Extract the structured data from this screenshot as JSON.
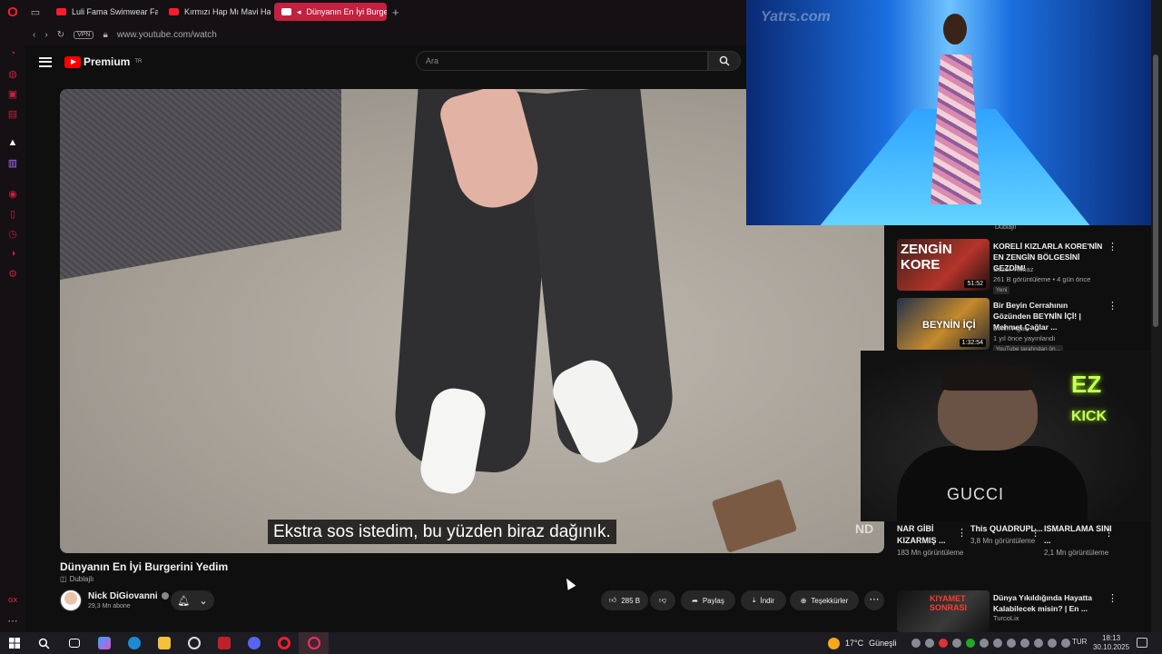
{
  "browser": {
    "tabs": [
      {
        "label": "Luli Fama Swimwear Fash"
      },
      {
        "label": "Kırmızı Hap Mı Mavi Hap"
      },
      {
        "label": "Dünyanın En İyi Burge"
      }
    ],
    "vpn_label": "VPN",
    "url": "www.youtube.com/watch",
    "sidebar_bottom_label": "GX"
  },
  "youtube": {
    "logo_text": "Premium",
    "logo_region": "TR",
    "search_placeholder": "Ara"
  },
  "video": {
    "subtitle": "Ekstra sos istedim, bu yüzden biraz dağınık.",
    "watermark": "ND",
    "title": "Dünyanın En İyi Burgerini Yedim",
    "dubbed_label": "Dublajlı",
    "channel_name": "Nick DiGiovanni",
    "subscribers": "29,3 Mn abone",
    "like_count": "285 B",
    "share_label": "Paylaş",
    "download_label": "İndir",
    "thanks_label": "Teşekkürler"
  },
  "pip": {
    "watermark": "Yatrs.com"
  },
  "recommendations": [
    {
      "thumb_text": "ZENGİN KORE",
      "duration": "51:52",
      "title": "KORELİ KIZLARLA KORE'NİN EN ZENGİN BÖLGESİNİ GEZDİM!",
      "channel": "Sezer Yılmaz",
      "meta": "261 B görüntüleme • 4 gün önce",
      "badge": "Yeni"
    },
    {
      "thumb_text": "BEYNİN İÇİ",
      "duration": "1:32:54",
      "title": "Bir Beyin Cerrahının Gözünden BEYNİN İÇİ! | Mehmet Çağlar ...",
      "channel": "Evrim Ağacı",
      "meta": "1 yıl önce yayınlandı",
      "badge": "YouTube tarafından ön..."
    },
    {
      "thumb_text": "KIYAMET SONRASI",
      "duration": "",
      "title": "Dünya Yıkıldığında Hayatta Kalabilecek misin? | En ...",
      "channel": "TurcoLix",
      "meta": "",
      "badge": ""
    }
  ],
  "dubbed_top": "Dublajlı",
  "cam": {
    "neon_top": "EZ",
    "neon_bottom": "KICK",
    "shirt_text": "GUCCI"
  },
  "shorts": [
    {
      "title": "NAR GİBİ KIZARMIŞ ...",
      "views": "183 Mn görüntüleme"
    },
    {
      "title": "This QUADRUPL...",
      "views": "3,8 Mn görüntüleme"
    },
    {
      "title": "ISMARLAMA SINI ...",
      "views": "2,1 Mn görüntüleme"
    }
  ],
  "taskbar": {
    "weather": "17°C",
    "weather_desc": "Güneşli",
    "lang": "TUR",
    "time": "18:13",
    "date": "30.10.2025"
  },
  "colors": {
    "opera_red": "#ff1b2d",
    "active_tab": "#c4203f",
    "youtube_red": "#ff0000"
  }
}
